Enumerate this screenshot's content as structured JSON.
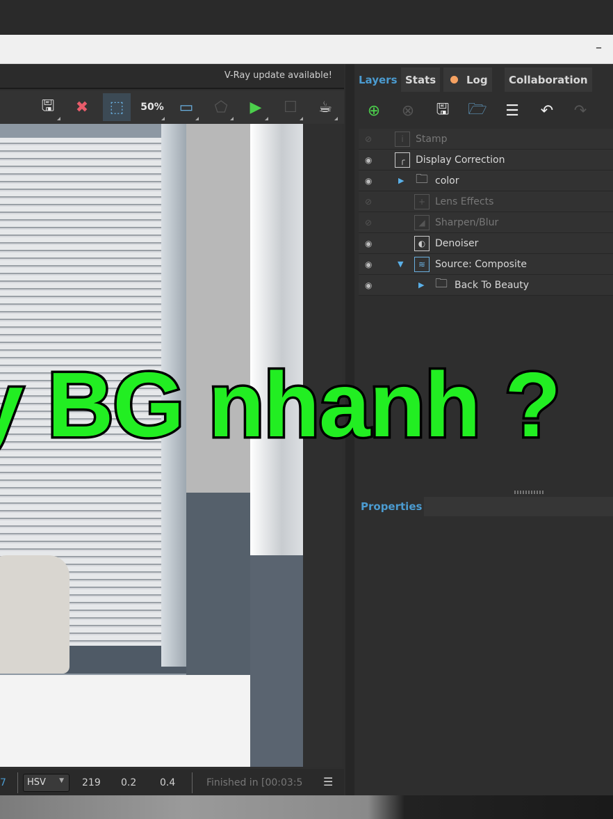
{
  "window": {
    "minimize": "–"
  },
  "vfb": {
    "update_notice": "V-Ray update available!",
    "toolbar": [
      {
        "icon": "save-icon",
        "glyph": "🖫"
      },
      {
        "icon": "clear-image-icon",
        "glyph": "✖"
      },
      {
        "icon": "region-render-icon",
        "glyph": "⬚"
      },
      {
        "icon": "zoom-50-icon",
        "glyph": "50%"
      },
      {
        "icon": "window-icon",
        "glyph": "▭"
      },
      {
        "icon": "track-mouse-icon",
        "glyph": "⬠"
      },
      {
        "icon": "render-interactive-icon",
        "glyph": "▶"
      },
      {
        "icon": "stop-render-icon",
        "glyph": "☐"
      },
      {
        "icon": "render-teapot-icon",
        "glyph": "☕"
      }
    ]
  },
  "status": {
    "value_prefix": "7",
    "color_mode": "HSV",
    "h": "219",
    "s": "0.2",
    "v": "0.4",
    "message": "Finished in [00:03:5"
  },
  "tabs": [
    {
      "label": "Layers",
      "active": true
    },
    {
      "label": "Stats"
    },
    {
      "label": "Log",
      "dot_color": "#f6a262"
    },
    {
      "label": "Collaboration"
    }
  ],
  "layer_toolbar": [
    "add-layer-icon",
    "delete-layer-icon",
    "save-layers-icon",
    "load-layers-icon",
    "list-icon",
    "undo-icon",
    "redo-icon"
  ],
  "layers": [
    {
      "label": "Stamp",
      "enabled": false,
      "icon": "stamp-icon"
    },
    {
      "label": "Display Correction",
      "enabled": true,
      "icon": "curve-icon"
    },
    {
      "label": "color",
      "enabled": true,
      "icon": "folder-icon",
      "expandable": "collapsed"
    },
    {
      "label": "Lens Effects",
      "enabled": false,
      "icon": "lens-effects-icon"
    },
    {
      "label": "Sharpen/Blur",
      "enabled": false,
      "icon": "sharpen-icon"
    },
    {
      "label": "Denoiser",
      "enabled": true,
      "icon": "denoiser-icon"
    },
    {
      "label": "Source: Composite",
      "enabled": true,
      "icon": "composite-icon",
      "expandable": "expanded"
    },
    {
      "label": "Back To Beauty",
      "enabled": true,
      "icon": "folder-icon",
      "expandable": "collapsed"
    }
  ],
  "properties": {
    "title": "Properties"
  },
  "overlay_text": "y BG nhanh ?",
  "colors": {
    "accent": "#4b9bd0",
    "overlay": "#22ee22"
  }
}
